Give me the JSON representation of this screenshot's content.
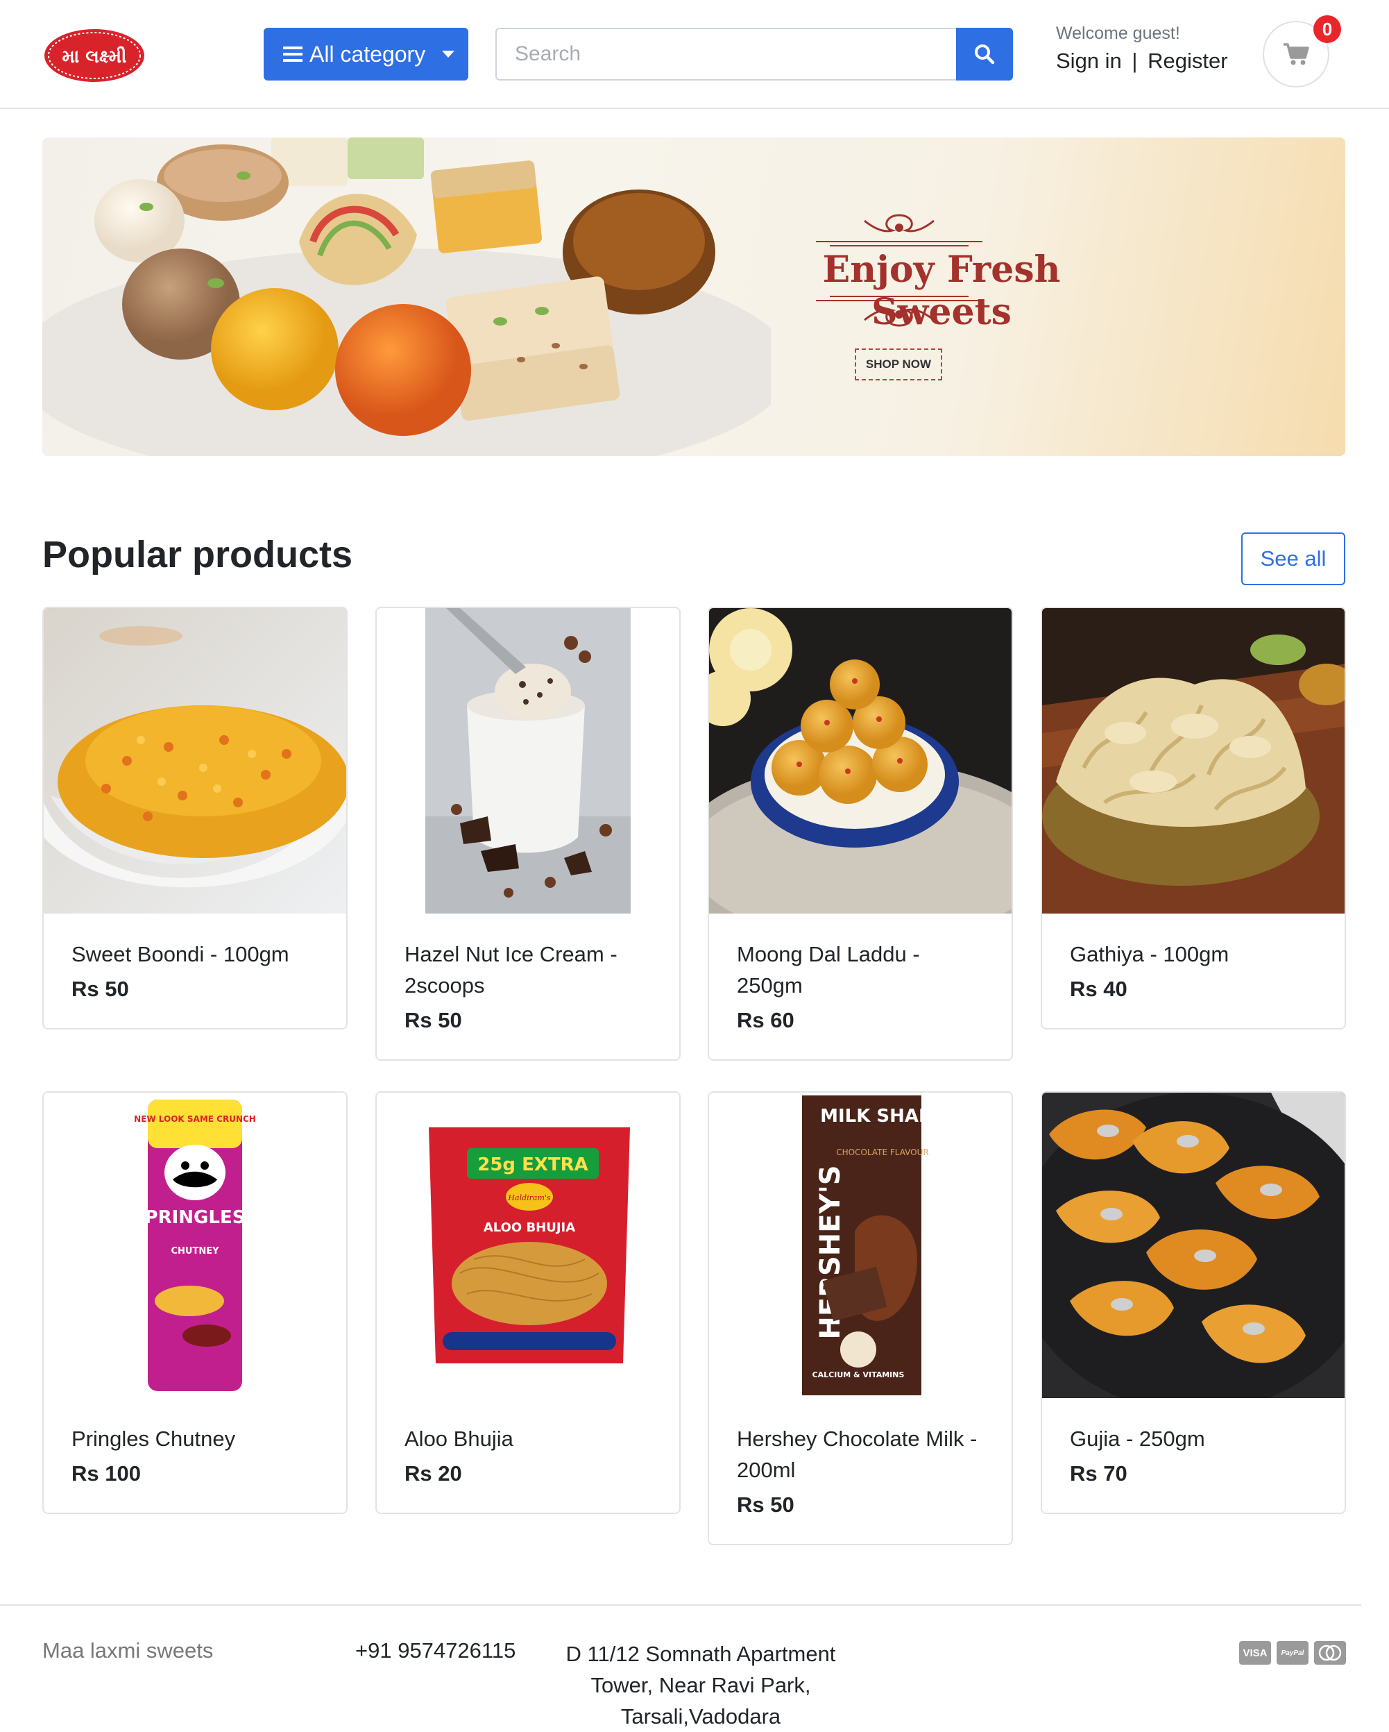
{
  "header": {
    "logo_text": "મા લક્ષ્મી",
    "category_label": "All category",
    "search_placeholder": "Search",
    "welcome": "Welcome guest!",
    "sign_in": "Sign in",
    "separator": "|",
    "register": "Register",
    "cart_count": "0"
  },
  "banner": {
    "title": "Enjoy Fresh Sweets",
    "cta": "SHOP NOW"
  },
  "popular": {
    "title": "Popular products",
    "see_all": "See all",
    "products": [
      {
        "name": "Sweet Boondi - 100gm",
        "price": "Rs 50"
      },
      {
        "name": "Hazel Nut Ice Cream - 2scoops",
        "price": "Rs 50"
      },
      {
        "name": "Moong Dal Laddu - 250gm",
        "price": "Rs 60"
      },
      {
        "name": "Gathiya - 100gm",
        "price": "Rs 40"
      },
      {
        "name": "Pringles Chutney",
        "price": "Rs 100"
      },
      {
        "name": "Aloo Bhujia",
        "price": "Rs 20"
      },
      {
        "name": "Hershey Chocolate Milk - 200ml",
        "price": "Rs 50"
      },
      {
        "name": "Gujia - 250gm",
        "price": "Rs 70"
      }
    ]
  },
  "product_images": {
    "pringles_top": "NEW LOOK SAME CRUNCH",
    "pringles_brand": "PRINGLES",
    "pringles_flavour": "CHUTNEY",
    "bhujia_extra": "25g EXTRA",
    "bhujia_brand": "Haldiram's",
    "bhujia_name": "ALOO BHUJIA",
    "hershey_brand": "HERSHEY'S",
    "hershey_milk": "MILK SHAKE",
    "hershey_flavour": "CHOCOLATE FLAVOUR",
    "hershey_fortified": "CALCIUM & VITAMINS"
  },
  "footer": {
    "brand": "Maa laxmi sweets",
    "phone": "+91 9574726115",
    "address": "D 11/12 Somnath Apartment Tower, Near Ravi Park, Tarsali,Vadodara",
    "payments": [
      "VISA",
      "PayPal",
      "mastercard"
    ]
  },
  "colors": {
    "primary": "#2f6fe4",
    "badge": "#e8262b",
    "banner_title": "#a3322c"
  }
}
